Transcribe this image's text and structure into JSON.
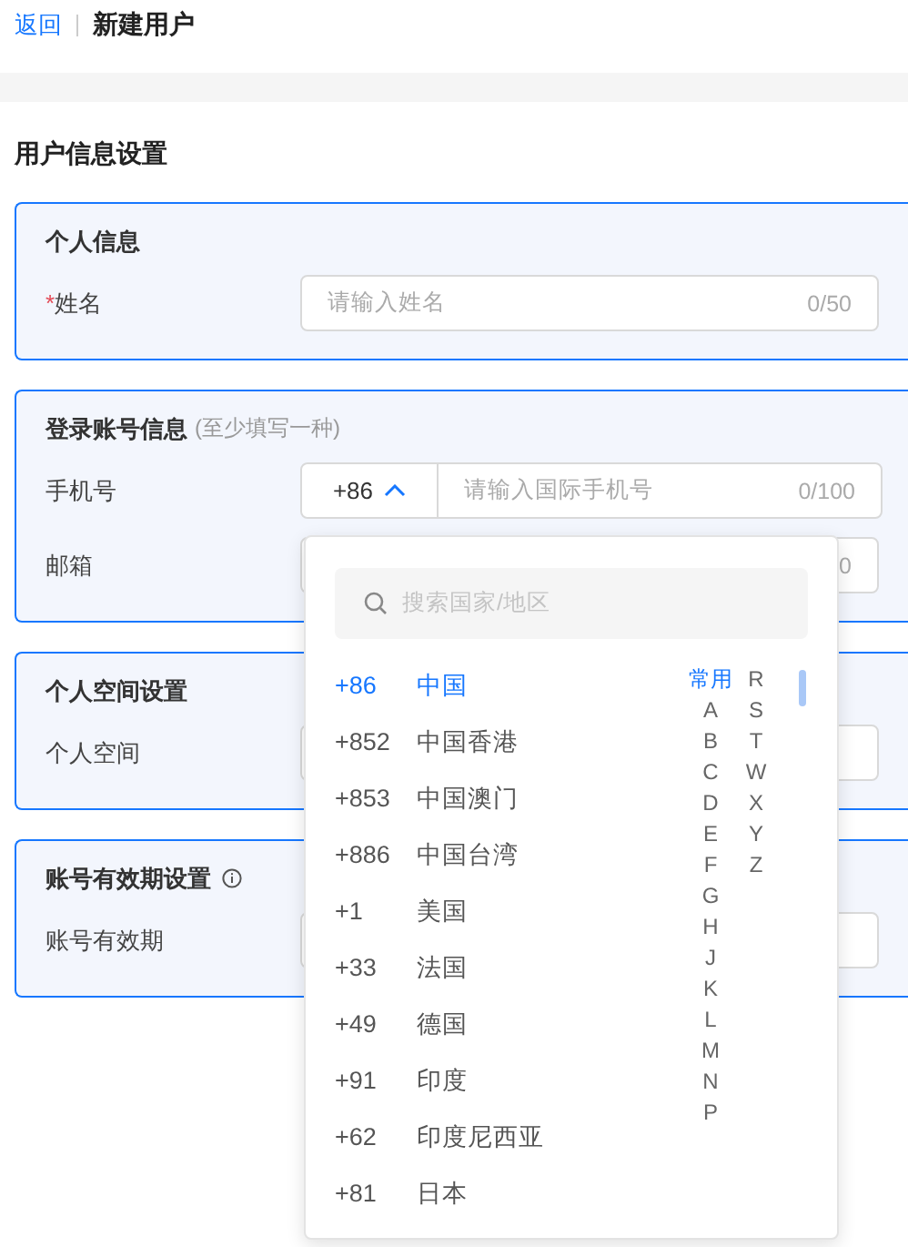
{
  "header": {
    "back_link": "返回",
    "title": "新建用户"
  },
  "section_title": "用户信息设置",
  "cards": [
    {
      "title": "个人信息",
      "info": false,
      "fields": [
        {
          "kind": "text",
          "label": "姓名",
          "required_mark": "*",
          "placeholder": "请输入姓名",
          "counter": "0/50"
        }
      ]
    },
    {
      "title": "登录账号信息",
      "hint": "(至少填写一种)",
      "info": false,
      "fields": [
        {
          "kind": "phone",
          "label": "手机号",
          "code": "+86",
          "expanded": true,
          "placeholder": "请输入国际手机号",
          "counter": "0/100"
        },
        {
          "kind": "text",
          "label": "邮箱",
          "counter": "0"
        }
      ]
    },
    {
      "title": "个人空间设置",
      "info": false,
      "fields": [
        {
          "kind": "text",
          "label": "个人空间"
        }
      ]
    },
    {
      "title": "账号有效期设置",
      "info": true,
      "fields": [
        {
          "kind": "text",
          "label": "账号有效期"
        }
      ]
    }
  ],
  "dropdown": {
    "search_placeholder": "搜索国家/地区",
    "countries": [
      {
        "code": "+86",
        "name": "中国",
        "selected": true
      },
      {
        "code": "+852",
        "name": "中国香港",
        "selected": false
      },
      {
        "code": "+853",
        "name": "中国澳门",
        "selected": false
      },
      {
        "code": "+886",
        "name": "中国台湾",
        "selected": false
      },
      {
        "code": "+1",
        "name": "美国",
        "selected": false
      },
      {
        "code": "+33",
        "name": "法国",
        "selected": false
      },
      {
        "code": "+49",
        "name": "德国",
        "selected": false
      },
      {
        "code": "+91",
        "name": "印度",
        "selected": false
      },
      {
        "code": "+62",
        "name": "印度尼西亚",
        "selected": false
      },
      {
        "code": "+81",
        "name": "日本",
        "selected": false
      }
    ],
    "index": [
      {
        "label": "常用",
        "selected": true
      },
      {
        "label": "A",
        "selected": false
      },
      {
        "label": "B",
        "selected": false
      },
      {
        "label": "C",
        "selected": false
      },
      {
        "label": "D",
        "selected": false
      },
      {
        "label": "E",
        "selected": false
      },
      {
        "label": "F",
        "selected": false
      },
      {
        "label": "G",
        "selected": false
      },
      {
        "label": "H",
        "selected": false
      },
      {
        "label": "J",
        "selected": false
      },
      {
        "label": "K",
        "selected": false
      },
      {
        "label": "L",
        "selected": false
      },
      {
        "label": "M",
        "selected": false
      },
      {
        "label": "N",
        "selected": false
      },
      {
        "label": "P",
        "selected": false
      },
      {
        "label": "R",
        "selected": false
      },
      {
        "label": "S",
        "selected": false
      },
      {
        "label": "T",
        "selected": false
      },
      {
        "label": "W",
        "selected": false
      },
      {
        "label": "X",
        "selected": false
      },
      {
        "label": "Y",
        "selected": false
      },
      {
        "label": "Z",
        "selected": false
      }
    ]
  }
}
